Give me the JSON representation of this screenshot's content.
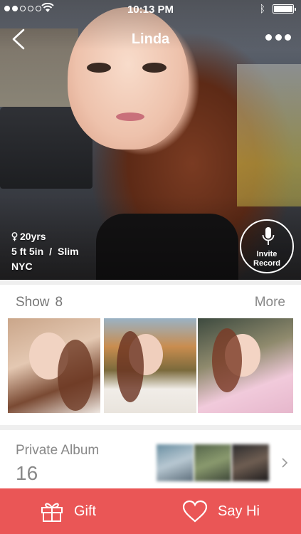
{
  "status_bar": {
    "time": "10:13 PM",
    "signal_bars_filled": 2,
    "signal_bars_total": 5,
    "battery_level": 1.0
  },
  "nav": {
    "title": "Linda"
  },
  "profile": {
    "age": "20yrs",
    "height": "5 ft  5in",
    "separator": "/",
    "body_type": "Slim",
    "location": "NYC"
  },
  "invite": {
    "line1": "Invite",
    "line2": "Record"
  },
  "show": {
    "label": "Show",
    "count": "8",
    "more_label": "More"
  },
  "private_album": {
    "label": "Private Album",
    "count": "16"
  },
  "actions": {
    "gift_label": "Gift",
    "say_hi_label": "Say Hi"
  },
  "colors": {
    "accent": "#ea5656",
    "text_muted": "#888888",
    "background": "#efefef"
  },
  "icons": {
    "back": "chevron-left-icon",
    "more": "ellipsis-icon",
    "mic": "microphone-icon",
    "gift": "gift-icon",
    "heart": "heart-icon",
    "female": "female-icon",
    "chevron": "chevron-right-icon"
  }
}
